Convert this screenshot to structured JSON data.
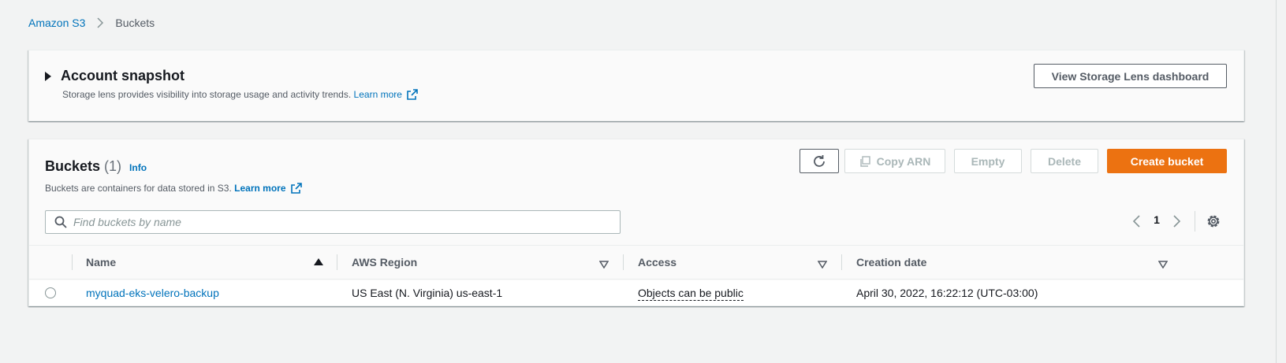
{
  "breadcrumb": {
    "root": "Amazon S3",
    "current": "Buckets"
  },
  "snapshot": {
    "title": "Account snapshot",
    "description": "Storage lens provides visibility into storage usage and activity trends.",
    "learn_more": "Learn more",
    "view_button": "View Storage Lens dashboard"
  },
  "buckets": {
    "title": "Buckets",
    "count": "(1)",
    "info": "Info",
    "description": "Buckets are containers for data stored in S3.",
    "learn_more": "Learn more",
    "toolbar": {
      "copy_arn": "Copy ARN",
      "empty": "Empty",
      "delete": "Delete",
      "create": "Create bucket"
    },
    "search": {
      "placeholder": "Find buckets by name",
      "value": ""
    },
    "pagination": {
      "current_page": "1"
    },
    "columns": [
      "Name",
      "AWS Region",
      "Access",
      "Creation date"
    ],
    "rows": [
      {
        "name": "myquad-eks-velero-backup",
        "region": "US East (N. Virginia) us-east-1",
        "access": "Objects can be public",
        "created": "April 30, 2022, 16:22:12 (UTC-03:00)"
      }
    ]
  },
  "colors": {
    "link": "#0073bb",
    "primary_button": "#ec7211",
    "page_background": "#f2f3f3"
  },
  "icons": {
    "breadcrumb_separator": "chevron-right-icon",
    "external_link": "external-link-icon",
    "refresh": "refresh-icon",
    "copy": "copy-icon",
    "search": "search-icon",
    "settings": "gear-icon"
  }
}
